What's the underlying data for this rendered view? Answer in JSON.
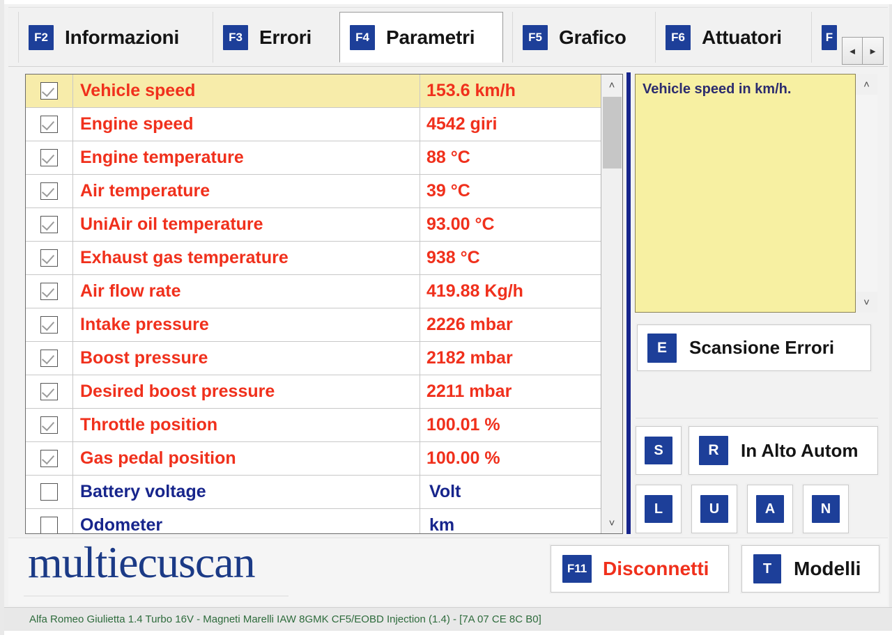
{
  "tabs": [
    {
      "fkey": "F2",
      "label": "Informazioni",
      "active": false
    },
    {
      "fkey": "F3",
      "label": "Errori",
      "active": false
    },
    {
      "fkey": "F4",
      "label": "Parametri",
      "active": true
    },
    {
      "fkey": "F5",
      "label": "Grafico",
      "active": false
    },
    {
      "fkey": "F6",
      "label": "Attuatori",
      "active": false
    },
    {
      "fkey": "F",
      "label": "",
      "active": false
    }
  ],
  "tab_scroll": {
    "prev": "◄",
    "next": "►"
  },
  "parameters": [
    {
      "checked": true,
      "name": "Vehicle speed",
      "value": "153.6 km/h",
      "selected": true
    },
    {
      "checked": true,
      "name": "Engine speed",
      "value": "4542 giri",
      "selected": false
    },
    {
      "checked": true,
      "name": "Engine temperature",
      "value": "88 °C",
      "selected": false
    },
    {
      "checked": true,
      "name": "Air temperature",
      "value": "39 °C",
      "selected": false
    },
    {
      "checked": true,
      "name": "UniAir oil temperature",
      "value": "93.00 °C",
      "selected": false
    },
    {
      "checked": true,
      "name": "Exhaust gas temperature",
      "value": "938 °C",
      "selected": false
    },
    {
      "checked": true,
      "name": "Air flow rate",
      "value": "419.88 Kg/h",
      "selected": false
    },
    {
      "checked": true,
      "name": "Intake pressure",
      "value": "2226 mbar",
      "selected": false
    },
    {
      "checked": true,
      "name": "Boost pressure",
      "value": "2182 mbar",
      "selected": false
    },
    {
      "checked": true,
      "name": "Desired boost pressure",
      "value": "2211 mbar",
      "selected": false
    },
    {
      "checked": true,
      "name": "Throttle position",
      "value": "100.01 %",
      "selected": false
    },
    {
      "checked": true,
      "name": "Gas pedal position",
      "value": "100.00 %",
      "selected": false
    },
    {
      "checked": false,
      "name": "Battery voltage",
      "value": "Volt",
      "selected": false,
      "inactive": true
    },
    {
      "checked": false,
      "name": "Odometer",
      "value": "km",
      "selected": false,
      "inactive": true
    }
  ],
  "description": {
    "text": "Vehicle speed in km/h."
  },
  "right_buttons": {
    "scan_errors": {
      "fkey": "E",
      "label": "Scansione Errori"
    },
    "s": {
      "fkey": "S",
      "label": ""
    },
    "in_alto_autom": {
      "fkey": "R",
      "label": "In Alto Autom"
    },
    "l": {
      "fkey": "L",
      "label": ""
    },
    "u": {
      "fkey": "U",
      "label": ""
    },
    "a": {
      "fkey": "A",
      "label": ""
    },
    "n": {
      "fkey": "N",
      "label": ""
    }
  },
  "footer": {
    "logo": "multiecuscan",
    "disconnect": {
      "fkey": "F11",
      "label": "Disconnetti"
    },
    "models": {
      "fkey": "T",
      "label": "Modelli"
    }
  },
  "statusbar": {
    "text": "Alfa Romeo Giulietta 1.4 Turbo 16V - Magneti Marelli IAW 8GMK CF5/EOBD Injection (1.4) - [7A 07 CE 8C B0]"
  },
  "colors": {
    "accent_blue": "#1d3f99",
    "value_red": "#f0301c",
    "inactive_blue": "#17258c",
    "highlight_yellow": "#f7ecaa",
    "status_green": "#2e6b3c"
  },
  "scrollbars": {
    "up_glyph": "˄",
    "down_glyph": "˅"
  }
}
